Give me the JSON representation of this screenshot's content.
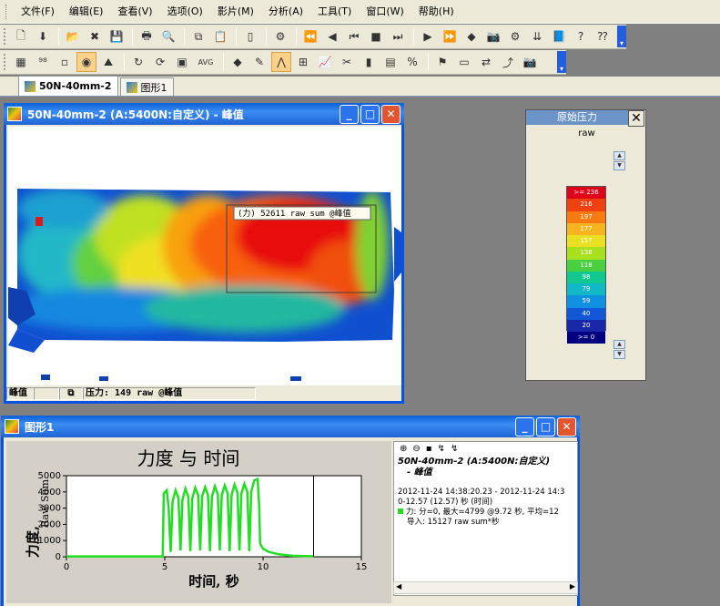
{
  "menu": [
    "文件(F)",
    "编辑(E)",
    "查看(V)",
    "选项(O)",
    "影片(M)",
    "分析(A)",
    "工具(T)",
    "窗口(W)",
    "帮助(H)"
  ],
  "toolbar2_text": "AVG",
  "tabs": [
    {
      "label": "50N-40mm-2",
      "active": true
    },
    {
      "label": "图形1",
      "active": false
    }
  ],
  "pressure_window": {
    "title": "50N-40mm-2 (A:5400N:自定义) - 峰值",
    "region_label": "(力) 52611 raw sum @峰值",
    "status": {
      "mode": "峰值",
      "readout": "压力: 149 raw @峰值"
    }
  },
  "palette": {
    "title": "原始压力",
    "subtitle": "raw",
    "max_value": "255",
    "min_value": "0",
    "scale": [
      {
        "label": ">= 236",
        "color": "#e0001a"
      },
      {
        "label": "216",
        "color": "#f04010"
      },
      {
        "label": "197",
        "color": "#f87a10"
      },
      {
        "label": "177",
        "color": "#f8b420"
      },
      {
        "label": "157",
        "color": "#e8e020"
      },
      {
        "label": "138",
        "color": "#a8e020"
      },
      {
        "label": "118",
        "color": "#48d040"
      },
      {
        "label": "98",
        "color": "#10c890"
      },
      {
        "label": "79",
        "color": "#10b8c8"
      },
      {
        "label": "59",
        "color": "#1090e0"
      },
      {
        "label": "40",
        "color": "#1058d8"
      },
      {
        "label": "20",
        "color": "#1828a8"
      },
      {
        ">": "",
        "label": ">= 0",
        "color": "#000080"
      }
    ]
  },
  "graph_window": {
    "title": "图形1",
    "legend": {
      "title_line1": "50N-40mm-2 (A:5400N:自定义)",
      "title_line2": "- 峰值",
      "line1": "2012-11-24 14:38:20.23 - 2012-11-24 14:3",
      "line2": "0-12.57 (12.57) 秒 (时间)",
      "line3": "力: 分=0, 最大=4799 @9.72 秒, 平均=12",
      "line4": "导入: 15127 raw sum*秒"
    }
  },
  "chart_data": {
    "type": "line",
    "title": "力度 与 时间",
    "xlabel": "时间, 秒",
    "ylabel_main": "力度,",
    "ylabel_side": "Raw Sum",
    "xlim": [
      0,
      15
    ],
    "ylim": [
      0,
      5000
    ],
    "xticks": [
      0,
      5,
      10,
      15
    ],
    "yticks": [
      0,
      1000,
      2000,
      3000,
      4000,
      5000
    ],
    "grid": false,
    "cursor_x": 12.57,
    "series": [
      {
        "color": "#22dd22",
        "points": [
          [
            0,
            20
          ],
          [
            4.9,
            20
          ],
          [
            4.95,
            3900
          ],
          [
            5.1,
            4100
          ],
          [
            5.2,
            3000
          ],
          [
            5.3,
            300
          ],
          [
            5.4,
            3400
          ],
          [
            5.55,
            4100
          ],
          [
            5.7,
            3600
          ],
          [
            5.8,
            400
          ],
          [
            5.9,
            3500
          ],
          [
            6.05,
            4200
          ],
          [
            6.2,
            3700
          ],
          [
            6.3,
            350
          ],
          [
            6.4,
            3600
          ],
          [
            6.55,
            4250
          ],
          [
            6.7,
            3800
          ],
          [
            6.8,
            400
          ],
          [
            6.9,
            3700
          ],
          [
            7.05,
            4300
          ],
          [
            7.2,
            3800
          ],
          [
            7.3,
            350
          ],
          [
            7.4,
            3700
          ],
          [
            7.55,
            4350
          ],
          [
            7.7,
            3850
          ],
          [
            7.8,
            400
          ],
          [
            7.9,
            3800
          ],
          [
            8.05,
            4400
          ],
          [
            8.2,
            3900
          ],
          [
            8.3,
            350
          ],
          [
            8.4,
            3800
          ],
          [
            8.55,
            4450
          ],
          [
            8.7,
            3950
          ],
          [
            8.8,
            400
          ],
          [
            8.9,
            3900
          ],
          [
            9.05,
            4500
          ],
          [
            9.2,
            4000
          ],
          [
            9.3,
            350
          ],
          [
            9.4,
            4000
          ],
          [
            9.55,
            4700
          ],
          [
            9.72,
            4799
          ],
          [
            9.8,
            3200
          ],
          [
            9.85,
            800
          ],
          [
            10.0,
            500
          ],
          [
            10.3,
            300
          ],
          [
            10.8,
            150
          ],
          [
            11.5,
            60
          ],
          [
            12.57,
            30
          ]
        ]
      }
    ]
  }
}
